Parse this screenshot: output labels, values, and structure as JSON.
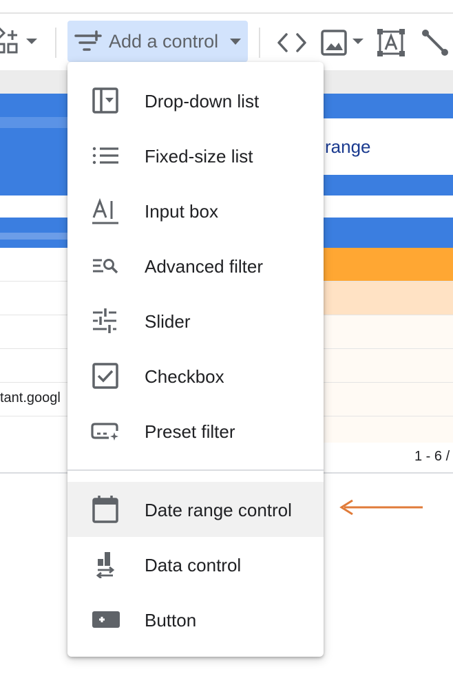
{
  "toolbar": {
    "add_control_label": "Add a control",
    "icons": [
      "add-component-icon",
      "filter-controls-icon",
      "code-embed-icon",
      "image-icon",
      "text-box-icon",
      "line-icon"
    ]
  },
  "menu": {
    "items": [
      {
        "label": "Drop-down list",
        "icon": "dropdown-list-icon"
      },
      {
        "label": "Fixed-size list",
        "icon": "fixed-size-list-icon"
      },
      {
        "label": "Input box",
        "icon": "input-box-icon"
      },
      {
        "label": "Advanced filter",
        "icon": "advanced-filter-icon"
      },
      {
        "label": "Slider",
        "icon": "slider-icon"
      },
      {
        "label": "Checkbox",
        "icon": "checkbox-icon"
      },
      {
        "label": "Preset filter",
        "icon": "preset-filter-icon"
      },
      {
        "label": "Date range control",
        "icon": "calendar-icon"
      },
      {
        "label": "Data control",
        "icon": "data-control-icon"
      },
      {
        "label": "Button",
        "icon": "button-icon"
      }
    ],
    "highlighted_item": "Date range control"
  },
  "report_background": {
    "header_fragment": "range",
    "url_fragment": "tant.googl",
    "pager_fragment": "1 - 6 /"
  },
  "colors": {
    "accent_blue": "#3b7ee0",
    "button_highlight": "#d2e3fc",
    "orange": "#ffa733",
    "light_orange": "#ffe2c4",
    "arrow": "#e07b39"
  }
}
